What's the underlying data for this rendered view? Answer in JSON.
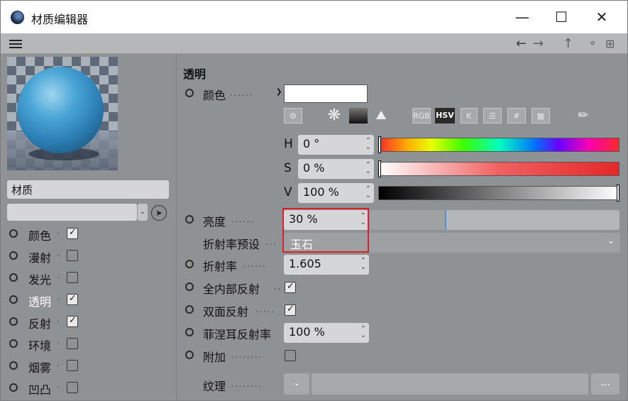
{
  "window": {
    "title": "材质编辑器",
    "minimize": "—",
    "maximize": "☐",
    "close": "✕"
  },
  "toolbar": {
    "back": "←",
    "forward": "→",
    "up": "↑",
    "lock": "🔒",
    "add": "⊞"
  },
  "material": {
    "name": "材质",
    "channels": [
      {
        "label": "颜色",
        "checked": true
      },
      {
        "label": "漫射",
        "checked": false
      },
      {
        "label": "发光",
        "checked": false
      },
      {
        "label": "透明",
        "checked": true,
        "active": true
      },
      {
        "label": "反射",
        "checked": true
      },
      {
        "label": "环境",
        "checked": false
      },
      {
        "label": "烟雾",
        "checked": false
      },
      {
        "label": "凹凸",
        "checked": false
      }
    ]
  },
  "transparency": {
    "section_title": "透明",
    "color_label": "颜色",
    "color_value": "#ffffff",
    "icons": {
      "rgb": "RGB",
      "hsv": "HSV",
      "k": "K",
      "hash": "#"
    },
    "h": {
      "letter": "H",
      "value": "0 °"
    },
    "s": {
      "letter": "S",
      "value": "0 %"
    },
    "v": {
      "letter": "V",
      "value": "100 %"
    },
    "brightness": {
      "label": "亮度",
      "value": "30 %",
      "level": 0.3
    },
    "preset": {
      "label": "折射率预设",
      "value": "玉石"
    },
    "ior": {
      "label": "折射率",
      "value": "1.605"
    },
    "total_internal": {
      "label": "全内部反射",
      "checked": true
    },
    "double_sided": {
      "label": "双面反射",
      "checked": true
    },
    "fresnel": {
      "label": "菲涅耳反射率",
      "value": "100 %"
    },
    "additive": {
      "label": "附加",
      "checked": false
    },
    "texture": {
      "label": "纹理",
      "more": "..."
    }
  },
  "colors": {
    "accent_highlight": "#e02020",
    "panel": "#8f9295"
  }
}
